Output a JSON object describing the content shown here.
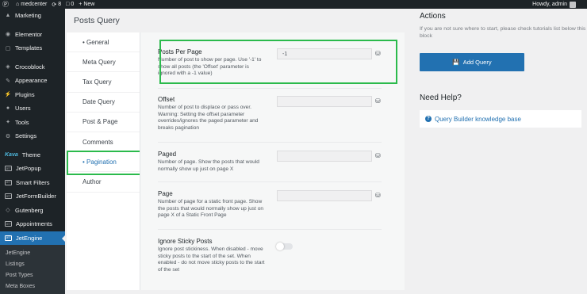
{
  "adminbar": {
    "site_name": "medcenter",
    "updates_count": "8",
    "comments_count": "0",
    "new_label": "New",
    "greeting": "Howdy, admin"
  },
  "sidebar": {
    "items": [
      {
        "label": "Marketing",
        "icon": "megaphone-icon"
      },
      {
        "label": "Elementor",
        "icon": "elementor-icon"
      },
      {
        "label": "Templates",
        "icon": "folder-icon"
      },
      {
        "label": "Crocoblock",
        "icon": "crocoblock-icon"
      },
      {
        "label": "Appearance",
        "icon": "paintbrush-icon"
      },
      {
        "label": "Plugins",
        "icon": "plug-icon"
      },
      {
        "label": "Users",
        "icon": "user-icon"
      },
      {
        "label": "Tools",
        "icon": "wrench-icon"
      },
      {
        "label": "Settings",
        "icon": "settings-icon"
      },
      {
        "label": "Theme",
        "icon": "theme-logo-icon"
      },
      {
        "label": "JetPopup",
        "icon": "jet-icon"
      },
      {
        "label": "Smart Filters",
        "icon": "jet-icon"
      },
      {
        "label": "JetFormBuilder",
        "icon": "jet-icon"
      },
      {
        "label": "Gutenberg",
        "icon": "gutenberg-icon"
      },
      {
        "label": "Appointments",
        "icon": "jet-icon"
      },
      {
        "label": "JetEngine",
        "icon": "jet-icon"
      }
    ],
    "submenu": [
      "JetEngine",
      "Listings",
      "Post Types",
      "Meta Boxes"
    ],
    "theme_logo_text": "Kava"
  },
  "main": {
    "title": "Posts Query",
    "tabs": [
      "General",
      "Meta Query",
      "Tax Query",
      "Date Query",
      "Post & Page",
      "Comments",
      "Pagination",
      "Author"
    ],
    "active_tab": "Pagination",
    "fields": [
      {
        "label": "Posts Per Page",
        "desc": "Number of post to show per page. Use '-1' to show all posts (the 'Offset' parameter is ignored with a -1 value)",
        "value": "-1"
      },
      {
        "label": "Offset",
        "desc": "Number of post to displace or pass over. Warning: Setting the offset parameter overrides/ignores the paged parameter and breaks pagination",
        "value": ""
      },
      {
        "label": "Paged",
        "desc": "Number of page. Show the posts that would normally show up just on page X",
        "value": ""
      },
      {
        "label": "Page",
        "desc": "Number of page for a static front page. Show the posts that would normally show up just on page X of a Static Front Page",
        "value": ""
      },
      {
        "label": "Ignore Sticky Posts",
        "desc": "Ignore post stickiness. When disabled - move sticky posts to the start of the set. When enabled - do not move sticky posts to the start of the set",
        "toggle": false
      }
    ]
  },
  "actions": {
    "title": "Actions",
    "hint": "If you are not sure where to start, please check tutorials list below this block",
    "add_button": "Add Query",
    "help_title": "Need Help?",
    "help_link": "Query Builder knowledge base"
  },
  "colors": {
    "accent": "#2271b1",
    "highlight": "#2bba4c",
    "admin_dark": "#1d2327"
  }
}
